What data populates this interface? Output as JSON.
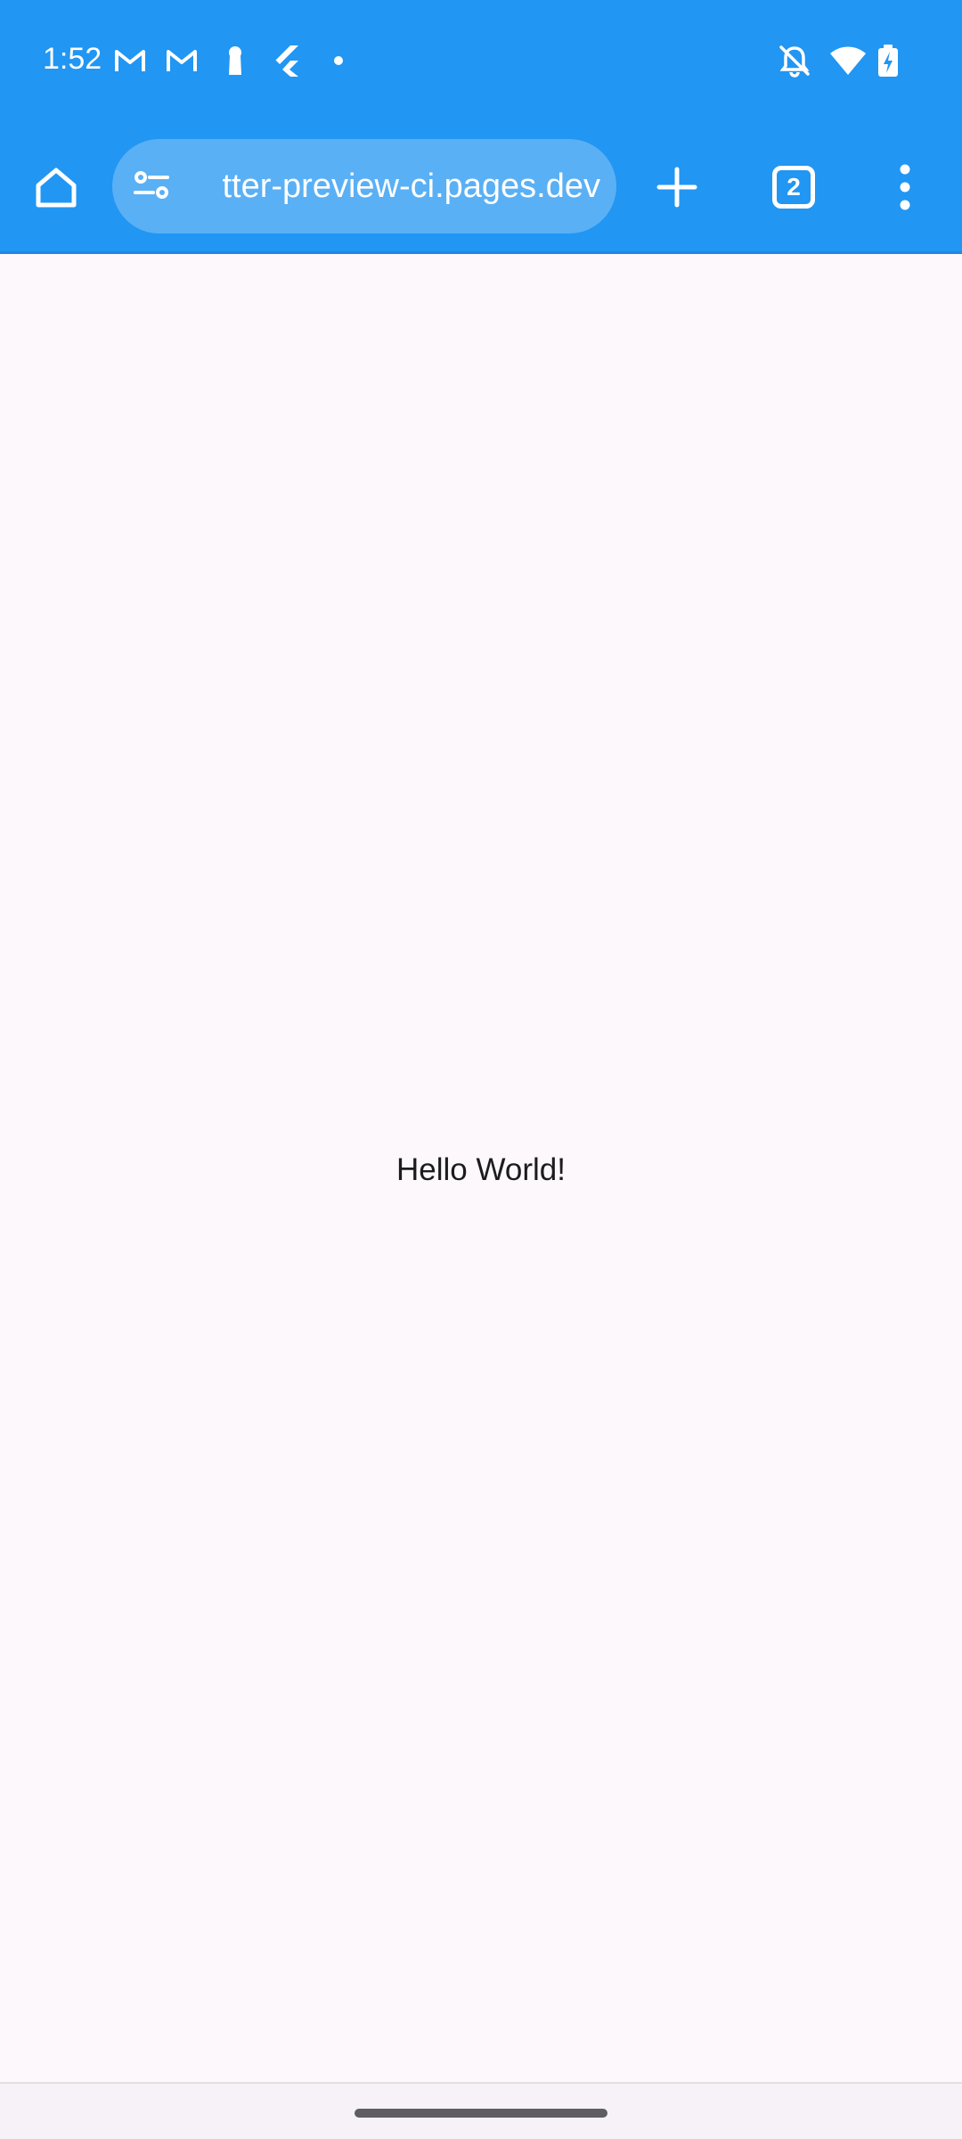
{
  "status_bar": {
    "time": "1:52",
    "left_icons": [
      "gmail-icon",
      "gmail-icon",
      "keyhole-icon",
      "flutter-icon",
      "dot-icon"
    ],
    "right_icons": [
      "bell-off-icon",
      "wifi-icon",
      "battery-charging-icon"
    ]
  },
  "toolbar": {
    "url": "tter-preview-ci.pages.dev",
    "tab_count": "2",
    "icons": [
      "home-icon",
      "site-settings-icon",
      "new-tab-icon",
      "tab-switcher-icon",
      "overflow-menu-icon"
    ]
  },
  "content": {
    "text": "Hello World!"
  },
  "colors": {
    "toolbar": "#2196F3",
    "omnibox": "#5AB0F5",
    "page_background": "#FCF8FC",
    "text": "#1C1B1F"
  }
}
